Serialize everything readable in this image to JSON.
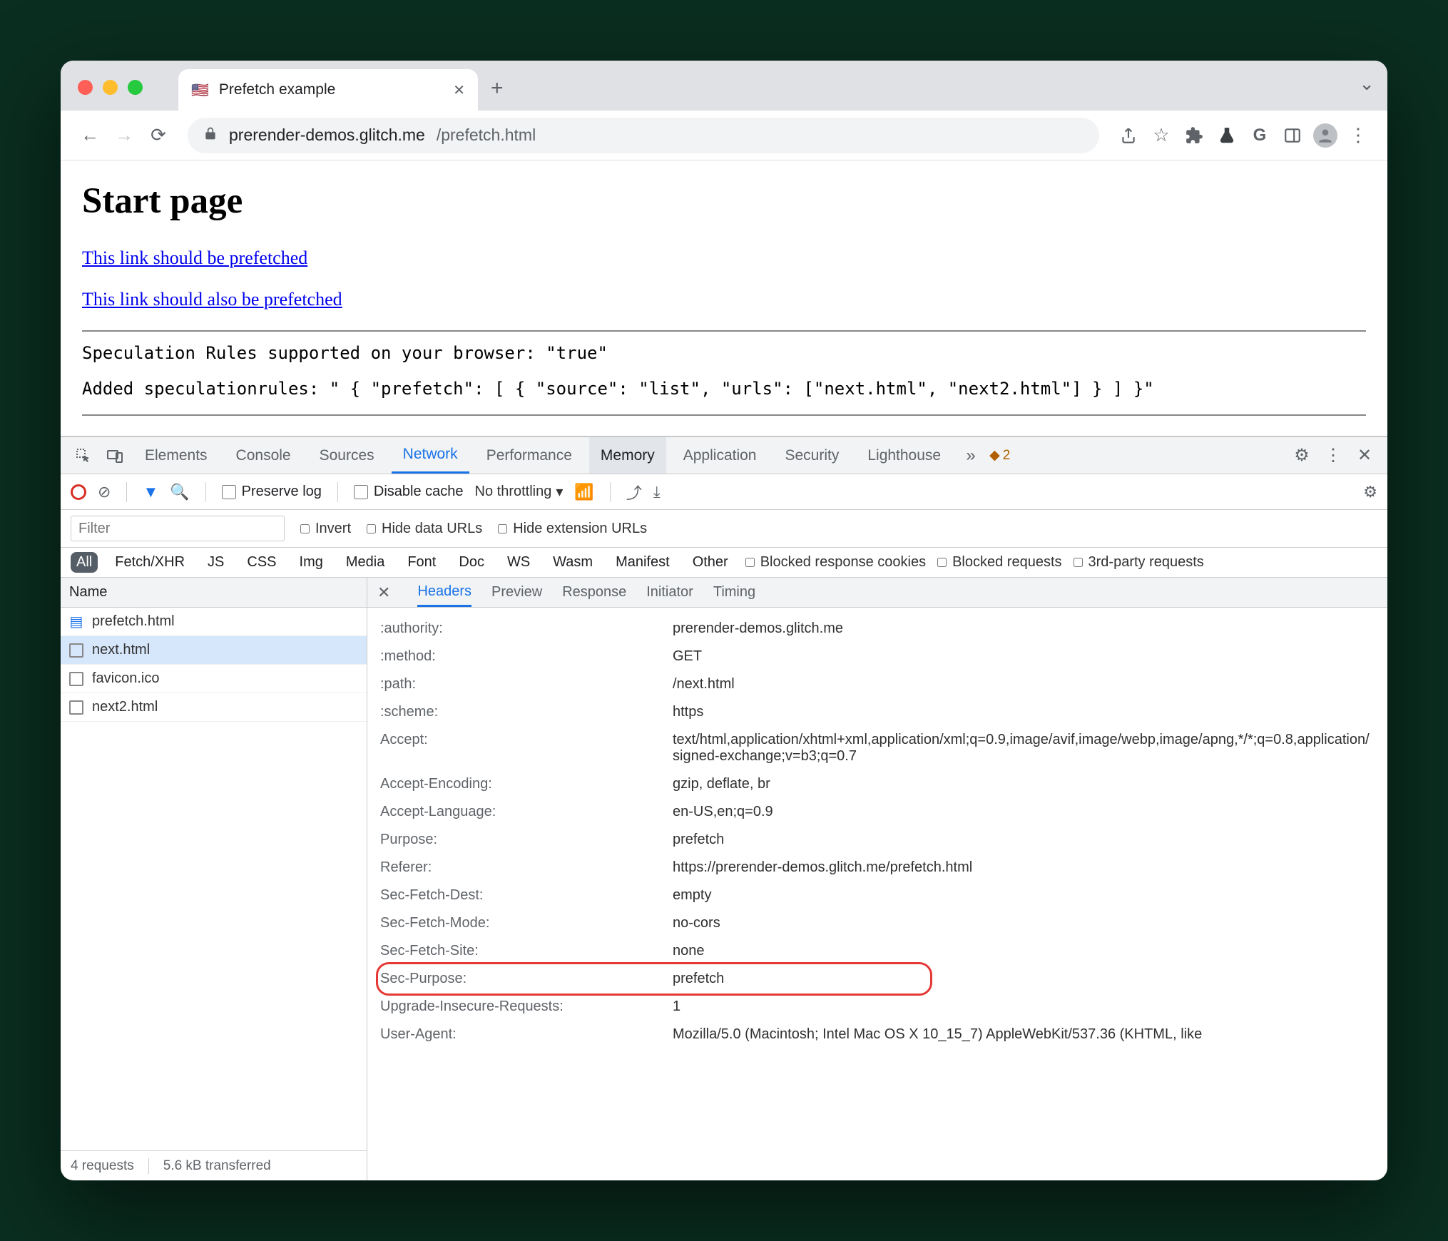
{
  "browser": {
    "tab_title": "Prefetch example",
    "url_domain": "prerender-demos.glitch.me",
    "url_path": "/prefetch.html"
  },
  "page": {
    "heading": "Start page",
    "link1": "This link should be prefetched",
    "link2": "This link should also be prefetched",
    "line1": "Speculation Rules supported on your browser: \"true\"",
    "line2": "Added speculationrules: \" { \"prefetch\": [ { \"source\": \"list\", \"urls\": [\"next.html\", \"next2.html\"] } ] }\""
  },
  "devtools": {
    "tabs": [
      "Elements",
      "Console",
      "Sources",
      "Network",
      "Performance",
      "Memory",
      "Application",
      "Security",
      "Lighthouse"
    ],
    "active_tab": "Network",
    "hidden_tabs_warn": "2",
    "subbar": {
      "preserve_log": "Preserve log",
      "disable_cache": "Disable cache",
      "throttling": "No throttling"
    },
    "filterbar": {
      "placeholder": "Filter",
      "invert": "Invert",
      "hide_data": "Hide data URLs",
      "hide_ext": "Hide extension URLs"
    },
    "types": [
      "All",
      "Fetch/XHR",
      "JS",
      "CSS",
      "Img",
      "Media",
      "Font",
      "Doc",
      "WS",
      "Wasm",
      "Manifest",
      "Other"
    ],
    "type_checks": {
      "blocked_cookies": "Blocked response cookies",
      "blocked_requests": "Blocked requests",
      "third_party": "3rd-party requests"
    },
    "requests_header": "Name",
    "requests": [
      {
        "name": "prefetch.html",
        "kind": "doc",
        "selected": false
      },
      {
        "name": "next.html",
        "kind": "other",
        "selected": true
      },
      {
        "name": "favicon.ico",
        "kind": "other",
        "selected": false
      },
      {
        "name": "next2.html",
        "kind": "other",
        "selected": false
      }
    ],
    "status": {
      "requests": "4 requests",
      "transferred": "5.6 kB transferred"
    },
    "details_tabs": [
      "Headers",
      "Preview",
      "Response",
      "Initiator",
      "Timing"
    ],
    "headers": [
      {
        "name": ":authority:",
        "value": "prerender-demos.glitch.me"
      },
      {
        "name": ":method:",
        "value": "GET"
      },
      {
        "name": ":path:",
        "value": "/next.html"
      },
      {
        "name": ":scheme:",
        "value": "https"
      },
      {
        "name": "Accept:",
        "value": "text/html,application/xhtml+xml,application/xml;q=0.9,image/avif,image/webp,image/apng,*/*;q=0.8,application/signed-exchange;v=b3;q=0.7"
      },
      {
        "name": "Accept-Encoding:",
        "value": "gzip, deflate, br"
      },
      {
        "name": "Accept-Language:",
        "value": "en-US,en;q=0.9"
      },
      {
        "name": "Purpose:",
        "value": "prefetch"
      },
      {
        "name": "Referer:",
        "value": "https://prerender-demos.glitch.me/prefetch.html"
      },
      {
        "name": "Sec-Fetch-Dest:",
        "value": "empty"
      },
      {
        "name": "Sec-Fetch-Mode:",
        "value": "no-cors"
      },
      {
        "name": "Sec-Fetch-Site:",
        "value": "none"
      },
      {
        "name": "Sec-Purpose:",
        "value": "prefetch",
        "highlight": true
      },
      {
        "name": "Upgrade-Insecure-Requests:",
        "value": "1"
      },
      {
        "name": "User-Agent:",
        "value": "Mozilla/5.0 (Macintosh; Intel Mac OS X 10_15_7) AppleWebKit/537.36 (KHTML, like"
      }
    ]
  }
}
